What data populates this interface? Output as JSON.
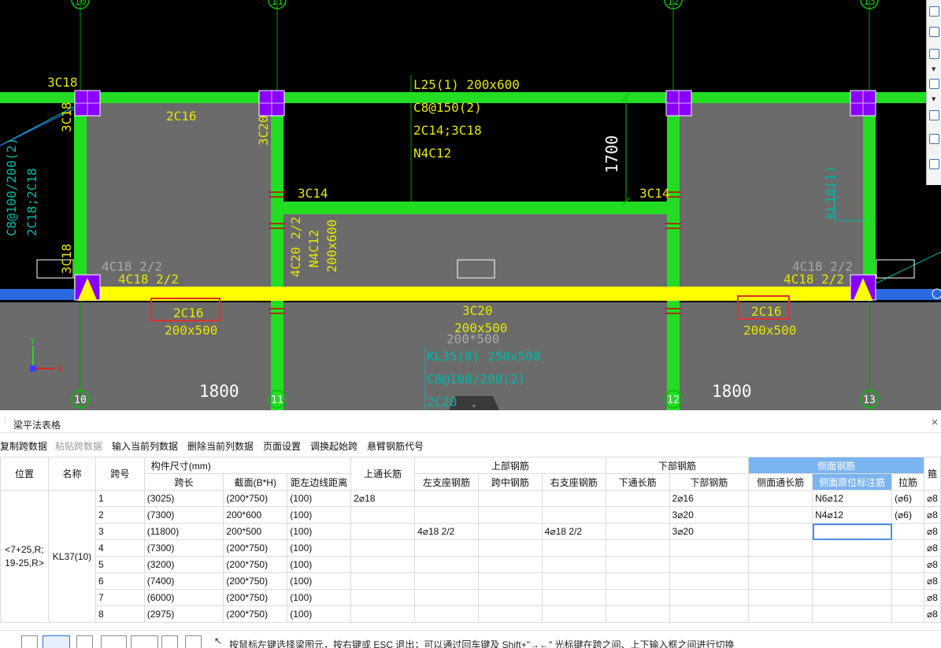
{
  "cad": {
    "axis_top": [
      "10",
      "11",
      "12",
      "13"
    ],
    "axis_bottom": [
      "10",
      "11",
      "12",
      "13"
    ],
    "texts": {
      "l25_line1": "L25(1) 200x600",
      "l25_line2": "C8@150(2)",
      "l25_line3": "2C14;3C18",
      "l25_line4": "N4C12",
      "dim_1700": "1700",
      "c3c18_top": "3C18",
      "c3c18_left": "3C18",
      "c2c16_top": "2C16",
      "c3c20": "3C20",
      "c3c14_left": "3C14",
      "c3c14_right": "3C14",
      "kl10": "KL10(1)",
      "left_stirrup": "C8@100/200(2)",
      "left_bars": "2C18;2C18",
      "c3c18_low": "3C18",
      "gray_4c18_left": "4C18 2/2",
      "yel_4c18_left": "4C18 2/2",
      "gray_4c18_right": "4C18 2/2",
      "yel_4c18_right": "4C18 2/2",
      "mid_4c20": "4C20 2/2",
      "mid_n4c12": "N4C12",
      "mid_200x600": "200x600",
      "left_span_bar": "2C16",
      "left_span_size": "200x500",
      "right_span_bar": "2C16",
      "right_span_size": "200x500",
      "center_3c20": "3C20",
      "center_200x500": "200x500",
      "center_gray_200x500": "200*500",
      "kl35": "KL35(8) 250x500",
      "kl35_stirrup": "C8@100/200(2)",
      "kl35_bar": "2C20",
      "dim_1800_left": "1800",
      "dim_1800_right": "1800",
      "ucs_y": "Y",
      "ucs_x": "X"
    },
    "colors": {
      "background": "#000000",
      "beam": "#22dd22",
      "selected_beam": "#ffff00",
      "slab": "#6b6b6b",
      "column": "#8a00ff",
      "annotation": "#e6e600",
      "cyan": "#00b7a8",
      "highlight_box": "#e03030"
    }
  },
  "panel": {
    "title": "梁平法表格",
    "close": "×",
    "toolbar": [
      {
        "label": "复制跨数据",
        "enabled": true
      },
      {
        "label": "粘贴跨数据",
        "enabled": false
      },
      {
        "label": "输入当前列数据",
        "enabled": true
      },
      {
        "label": "删除当前列数据",
        "enabled": true
      },
      {
        "label": "页面设置",
        "enabled": true
      },
      {
        "label": "调换起始跨",
        "enabled": true
      },
      {
        "label": "悬臂钢筋代号",
        "enabled": true
      }
    ]
  },
  "table": {
    "headers": {
      "position": "位置",
      "name": "名称",
      "span": "跨号",
      "member_size": "构件尺寸(mm)",
      "span_length": "跨长",
      "section": "截面(B*H)",
      "left_edge": "距左边线距离",
      "top_through": "上通长筋",
      "top_rebar": "上部钢筋",
      "left_support": "左支座钢筋",
      "mid_span": "跨中钢筋",
      "right_support": "右支座钢筋",
      "bottom_rebar": "下部钢筋",
      "bottom_through": "下通长筋",
      "bottom_bars": "下部钢筋",
      "side_rebar": "侧面钢筋",
      "side_through": "侧面通长筋",
      "side_original": "侧面原位标注筋",
      "tie": "拉筋",
      "extra": "箍"
    },
    "position": "<7+25,R;\n19-25,R>",
    "name": "KL37(10)",
    "rows": [
      {
        "span": "1",
        "length": "(3025)",
        "section": "(200*750)",
        "edge": "(100)",
        "top_through": "2⌀18",
        "left_support": "",
        "mid": "",
        "right_support": "",
        "bottom_through": "",
        "bottom": "2⌀16",
        "side_through": "",
        "side_orig": "N6⌀12",
        "tie": "(⌀6)",
        "extra": "⌀8"
      },
      {
        "span": "2",
        "length": "(7300)",
        "section": "200*600",
        "edge": "(100)",
        "top_through": "",
        "left_support": "",
        "mid": "",
        "right_support": "",
        "bottom_through": "",
        "bottom": "3⌀20",
        "side_through": "",
        "side_orig": "N4⌀12",
        "tie": "(⌀6)",
        "extra": "⌀8"
      },
      {
        "span": "3",
        "length": "(11800)",
        "section": "200*500",
        "edge": "(100)",
        "top_through": "",
        "left_support": "4⌀18 2/2",
        "mid": "",
        "right_support": "4⌀18 2/2",
        "bottom_through": "",
        "bottom": "3⌀20",
        "side_through": "",
        "side_orig": "",
        "tie": "",
        "extra": "⌀8"
      },
      {
        "span": "4",
        "length": "(7300)",
        "section": "(200*750)",
        "edge": "(100)",
        "top_through": "",
        "left_support": "",
        "mid": "",
        "right_support": "",
        "bottom_through": "",
        "bottom": "",
        "side_through": "",
        "side_orig": "",
        "tie": "",
        "extra": "⌀8"
      },
      {
        "span": "5",
        "length": "(3200)",
        "section": "(200*750)",
        "edge": "(100)",
        "top_through": "",
        "left_support": "",
        "mid": "",
        "right_support": "",
        "bottom_through": "",
        "bottom": "",
        "side_through": "",
        "side_orig": "",
        "tie": "",
        "extra": "⌀8"
      },
      {
        "span": "6",
        "length": "(7400)",
        "section": "(200*750)",
        "edge": "(100)",
        "top_through": "",
        "left_support": "",
        "mid": "",
        "right_support": "",
        "bottom_through": "",
        "bottom": "",
        "side_through": "",
        "side_orig": "",
        "tie": "",
        "extra": "⌀8"
      },
      {
        "span": "7",
        "length": "(6000)",
        "section": "(200*750)",
        "edge": "(100)",
        "top_through": "",
        "left_support": "",
        "mid": "",
        "right_support": "",
        "bottom_through": "",
        "bottom": "",
        "side_through": "",
        "side_orig": "",
        "tie": "",
        "extra": "⌀8"
      },
      {
        "span": "8",
        "length": "(2975)",
        "section": "(200*750)",
        "edge": "(100)",
        "top_through": "",
        "left_support": "",
        "mid": "",
        "right_support": "",
        "bottom_through": "",
        "bottom": "",
        "side_through": "",
        "side_orig": "",
        "tie": "",
        "extra": "⌀8"
      }
    ]
  },
  "statusbar": {
    "text": "按鼠标左键选择梁图元，按右键或 ESC 退出；可以通过回车键及 Shift+\"→←\" 光标键在跨之间、上下输入框之间进行切换",
    "tools": [
      "pointer-icon",
      "rectangle-select-icon",
      "cross-select-icon",
      "line-icon",
      "point-add-icon",
      "print-icon",
      "rotate-icon"
    ]
  }
}
